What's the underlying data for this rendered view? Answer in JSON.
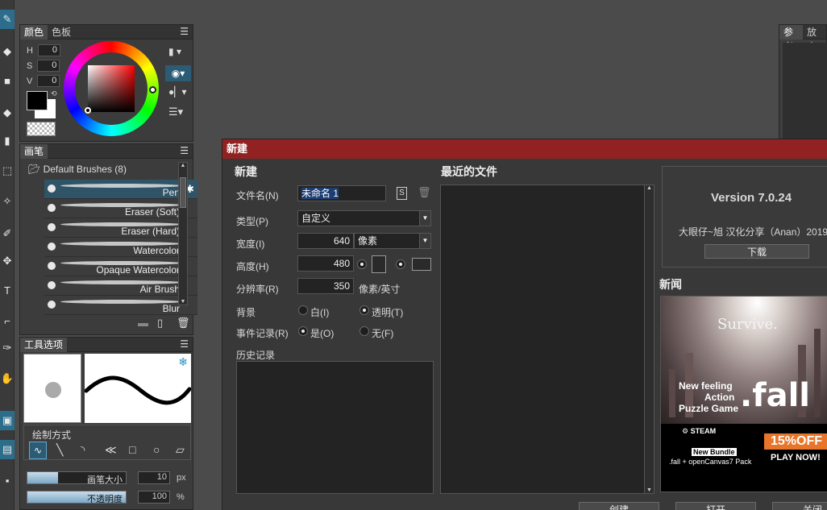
{
  "color_panel": {
    "tabs": [
      "颜色",
      "色板"
    ],
    "hsv": [
      {
        "label": "H",
        "value": "0"
      },
      {
        "label": "S",
        "value": "0"
      },
      {
        "label": "V",
        "value": "0"
      }
    ]
  },
  "brush_panel": {
    "title": "画笔",
    "group": "Default Brushes (8)",
    "brushes": [
      "Pen",
      "Eraser (Soft)",
      "Eraser (Hard)",
      "Watercolor",
      "Opaque Watercolor",
      "Air Brush",
      "Blur"
    ]
  },
  "tool_options": {
    "title": "工具选项",
    "draw_mode_label": "绘制方式",
    "brush_size_label": "画笔大小",
    "brush_size_value": "10",
    "brush_size_unit": "px",
    "opacity_label": "不透明度",
    "opacity_value": "100",
    "opacity_unit": "%"
  },
  "right_panel": {
    "tabs": [
      "参考",
      "放大"
    ]
  },
  "dialog": {
    "title": "新建",
    "new_heading": "新建",
    "filename_label": "文件名(N)",
    "filename_value": "未命名 1",
    "type_label": "类型(P)",
    "type_value": "自定义",
    "width_label": "宽度(I)",
    "width_value": "640",
    "unit_value": "像素",
    "height_label": "高度(H)",
    "height_value": "480",
    "resolution_label": "分辨率(R)",
    "resolution_value": "350",
    "resolution_unit": "像素/英寸",
    "background_label": "背景",
    "bg_white": "白(I)",
    "bg_transparent": "透明(T)",
    "event_label": "事件记录(R)",
    "event_yes": "是(O)",
    "event_no": "无(F)",
    "history_label": "历史记录",
    "recent_heading": "最近的文件",
    "version": "Version 7.0.24",
    "credits": "大眼仔~旭 汉化分享（Anan）2019",
    "download_button": "下载",
    "news_heading": "新闻",
    "buttons": [
      "创建",
      "打开",
      "关闭"
    ]
  },
  "news_ad": {
    "tagline": "Survive.",
    "line1": "New feeling",
    "line2": "Action",
    "line3": "Puzzle Game",
    "game": ".fall",
    "steam": "STEAM",
    "bundle": "New Bundle",
    "pack": ".fall + openCanvas7 Pack",
    "discount": "15%OFF",
    "cta": "PLAY NOW!"
  }
}
